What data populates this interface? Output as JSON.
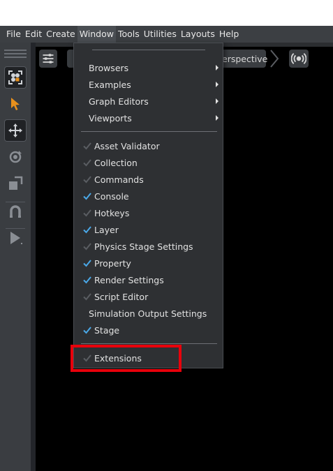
{
  "menubar": {
    "items": [
      "File",
      "Edit",
      "Create",
      "Window",
      "Tools",
      "Utilities",
      "Layouts",
      "Help"
    ],
    "active": "Window"
  },
  "viewport_toolbar": {
    "camera_label": "erspective"
  },
  "window_menu": {
    "submenus": [
      "Browsers",
      "Examples",
      "Graph Editors",
      "Viewports"
    ],
    "toggles": [
      {
        "label": "Asset Validator",
        "checked": false
      },
      {
        "label": "Collection",
        "checked": false
      },
      {
        "label": "Commands",
        "checked": false
      },
      {
        "label": "Console",
        "checked": true
      },
      {
        "label": "Hotkeys",
        "checked": false
      },
      {
        "label": "Layer",
        "checked": true
      },
      {
        "label": "Physics Stage Settings",
        "checked": false
      },
      {
        "label": "Property",
        "checked": true
      },
      {
        "label": "Render Settings",
        "checked": true
      },
      {
        "label": "Script Editor",
        "checked": false
      }
    ],
    "plain_item": "Simulation Output Settings",
    "stage": {
      "label": "Stage",
      "checked": true
    },
    "extensions": {
      "label": "Extensions",
      "checked": false
    }
  },
  "colors": {
    "check_on": "#4aa8e8",
    "check_off": "#5a5d62",
    "highlight": "#e8000b",
    "tool_accent": "#e8901c"
  },
  "icons": [
    "select-icon",
    "move-icon",
    "rotate-icon",
    "scale-icon",
    "snap-icon",
    "play-icon",
    "settings-sliders-icon",
    "broadcast-icon"
  ]
}
